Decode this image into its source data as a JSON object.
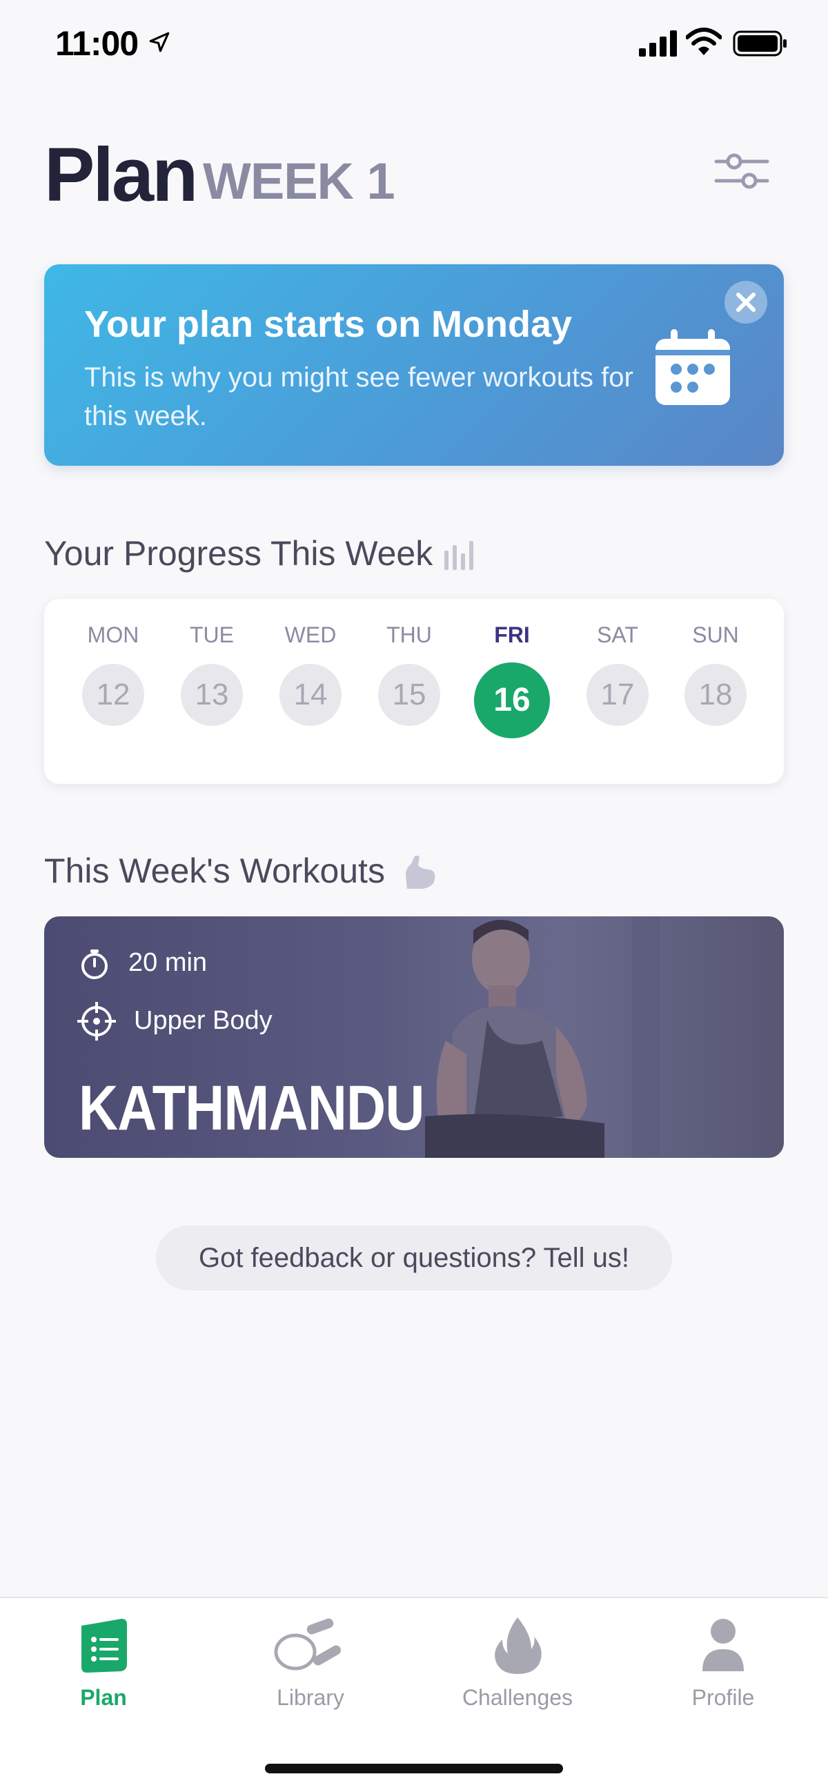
{
  "status_bar": {
    "time": "11:00"
  },
  "header": {
    "title": "Plan",
    "week": "WEEK 1"
  },
  "banner": {
    "title": "Your plan starts on Monday",
    "text": "This is why you might see fewer workouts for this week."
  },
  "progress": {
    "title": "Your Progress This Week",
    "days": [
      {
        "label": "MON",
        "num": "12"
      },
      {
        "label": "TUE",
        "num": "13"
      },
      {
        "label": "WED",
        "num": "14"
      },
      {
        "label": "THU",
        "num": "15"
      },
      {
        "label": "FRI",
        "num": "16"
      },
      {
        "label": "SAT",
        "num": "17"
      },
      {
        "label": "SUN",
        "num": "18"
      }
    ],
    "active_day": "FRI"
  },
  "workouts": {
    "title": "This Week's Workouts",
    "items": [
      {
        "duration": "20 min",
        "target": "Upper Body",
        "name": "KATHMANDU"
      }
    ]
  },
  "feedback": {
    "label": "Got feedback or questions? Tell us!"
  },
  "tab_bar": {
    "tabs": [
      {
        "label": "Plan",
        "icon": "plan-icon"
      },
      {
        "label": "Library",
        "icon": "jump-rope-icon"
      },
      {
        "label": "Challenges",
        "icon": "flame-icon"
      },
      {
        "label": "Profile",
        "icon": "person-icon"
      }
    ],
    "active": "Plan"
  },
  "colors": {
    "accent": "#1aa86a",
    "banner": "#4d99d6",
    "title": "#23233a"
  }
}
